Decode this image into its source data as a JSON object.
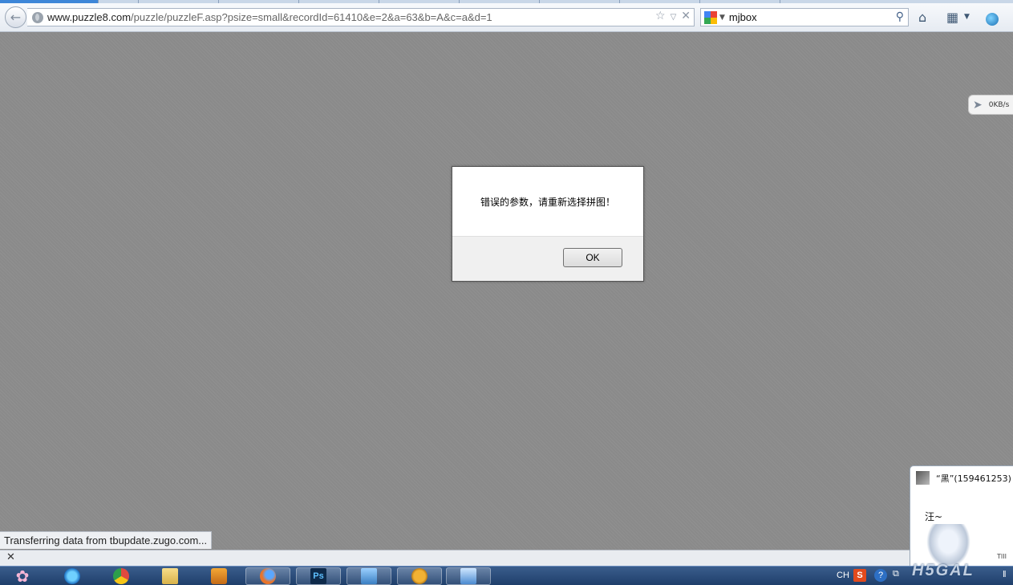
{
  "browser": {
    "url_host": "www.puzzle8.com",
    "url_path": "/puzzle/puzzleF.asp?psize=small&recordId=61410&e=2&a=63&b=A&c=a&d=1",
    "search_value": "mjbox",
    "status_text": "Transferring data from tbupdate.zugo.com...",
    "addon_close": "✕"
  },
  "speed_widget": {
    "text": "0KB/s"
  },
  "dialog": {
    "message": "错误的参数，请重新选择拼图！",
    "ok_label": "OK"
  },
  "qq_popup": {
    "sender": "“黑”(159461253)",
    "message": "汪~",
    "time": "TIII"
  },
  "taskbar": {
    "apps": [
      "start-orb",
      "internet-explorer",
      "chrome",
      "explorer",
      "media-player",
      "firefox",
      "photoshop",
      "film-app",
      "cat-app",
      "bird-app"
    ],
    "tray": {
      "lang": "CH",
      "ime": "S",
      "help": "?",
      "watermark": "H5GAL"
    }
  }
}
